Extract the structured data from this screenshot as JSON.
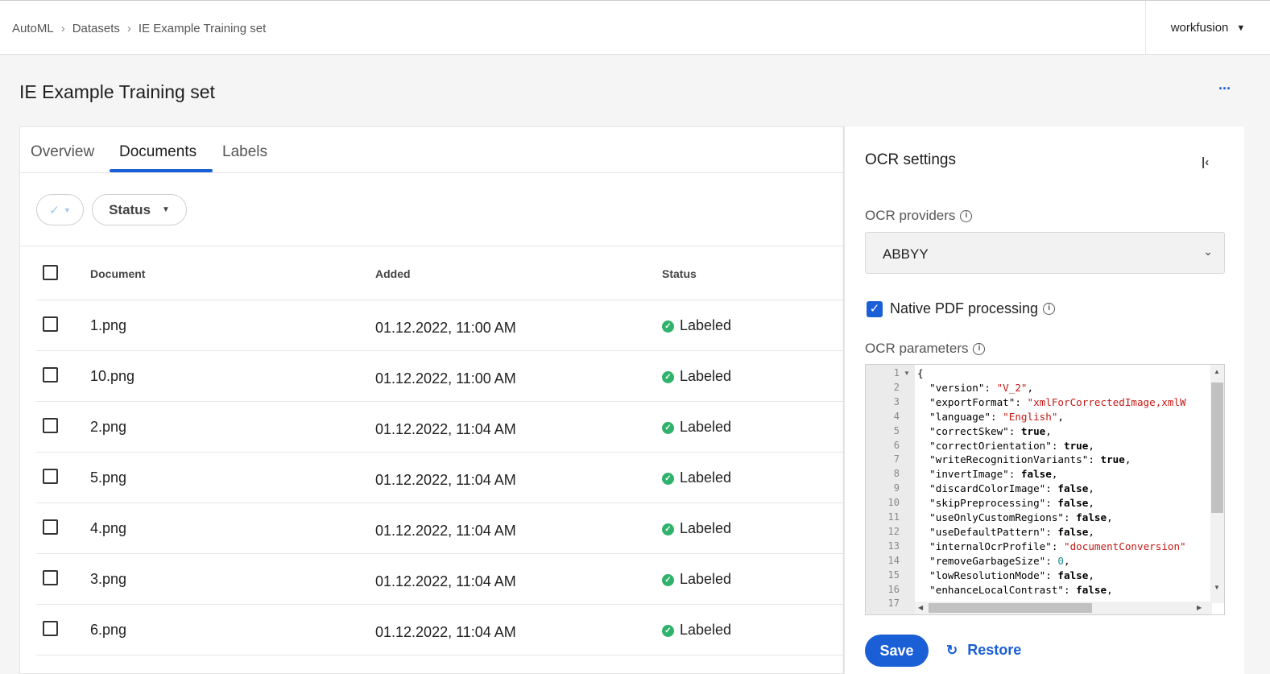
{
  "breadcrumb": [
    "AutoML",
    "Datasets",
    "IE Example Training set"
  ],
  "user": {
    "name": "workfusion"
  },
  "page": {
    "title": "IE Example Training set",
    "more_label": "···"
  },
  "tabs": [
    {
      "label": "Overview",
      "active": false
    },
    {
      "label": "Documents",
      "active": true
    },
    {
      "label": "Labels",
      "active": false
    }
  ],
  "filters": {
    "status_label": "Status"
  },
  "table": {
    "columns": [
      "Document",
      "Added",
      "Status"
    ],
    "rows": [
      {
        "document": "1.png",
        "added": "01.12.2022, 11:00 AM",
        "status": "Labeled"
      },
      {
        "document": "10.png",
        "added": "01.12.2022, 11:00 AM",
        "status": "Labeled"
      },
      {
        "document": "2.png",
        "added": "01.12.2022, 11:04 AM",
        "status": "Labeled"
      },
      {
        "document": "5.png",
        "added": "01.12.2022, 11:04 AM",
        "status": "Labeled"
      },
      {
        "document": "4.png",
        "added": "01.12.2022, 11:04 AM",
        "status": "Labeled"
      },
      {
        "document": "3.png",
        "added": "01.12.2022, 11:04 AM",
        "status": "Labeled"
      },
      {
        "document": "6.png",
        "added": "01.12.2022, 11:04 AM",
        "status": "Labeled"
      }
    ]
  },
  "ocr_panel": {
    "title": "OCR settings",
    "providers_label": "OCR providers",
    "provider_value": "ABBYY",
    "native_pdf_label": "Native PDF processing",
    "native_pdf_checked": true,
    "parameters_label": "OCR parameters",
    "code_lines": [
      "{",
      "  \"version\": \"V_2\",",
      "  \"exportFormat\": \"xmlForCorrectedImage,xmlW",
      "  \"language\": \"English\",",
      "  \"correctSkew\": true,",
      "  \"correctOrientation\": true,",
      "  \"writeRecognitionVariants\": true,",
      "  \"invertImage\": false,",
      "  \"discardColorImage\": false,",
      "  \"skipPreprocessing\": false,",
      "  \"useOnlyCustomRegions\": false,",
      "  \"useDefaultPattern\": false,",
      "  \"internalOcrProfile\": \"documentConversion\"",
      "  \"removeGarbageSize\": 0,",
      "  \"lowResolutionMode\": false,",
      "  \"enhanceLocalContrast\": false,",
      ""
    ],
    "save_label": "Save",
    "restore_label": "Restore"
  },
  "colors": {
    "accent": "#1a5fd6",
    "success": "#2fb36b",
    "string": "#c41a16"
  }
}
